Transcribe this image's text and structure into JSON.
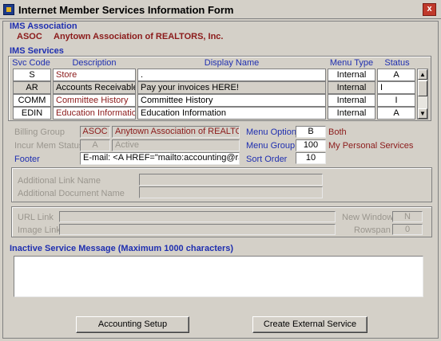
{
  "window": {
    "title": "Internet Member Services Information Form",
    "close_glyph": "x"
  },
  "association": {
    "section_label": "IMS Association",
    "code": "ASOC",
    "name": "Anytown Association of REALTORS, Inc."
  },
  "services": {
    "section_label": "IMS Services",
    "columns": {
      "svc_code": "Svc Code",
      "description": "Description",
      "display_name": "Display Name",
      "menu_type": "Menu Type",
      "status": "Status"
    },
    "rows": [
      {
        "code": "S",
        "description": "Store",
        "display_name": ".",
        "menu_type": "Internal",
        "status": "A"
      },
      {
        "code": "AR",
        "description": "Accounts Receivable",
        "display_name": "Pay your invoices HERE!",
        "menu_type": "Internal",
        "status": "I"
      },
      {
        "code": "COMM",
        "description": "Committee History",
        "display_name": "Committee History",
        "menu_type": "Internal",
        "status": "I"
      },
      {
        "code": "EDIN",
        "description": "Education Information",
        "display_name": "Education Information",
        "menu_type": "Internal",
        "status": "A"
      }
    ]
  },
  "details": {
    "billing_group_label": "Billing Group",
    "billing_group_code": "ASOC",
    "billing_group_name": "Anytown Association of REALTORS, I",
    "incur_mem_status_label": "Incur Mem Status",
    "incur_mem_status_code": "A",
    "incur_mem_status_name": "Active",
    "footer_label": "Footer",
    "footer_value": "E-mail: <A HREF=\"mailto:accounting@rapatton",
    "menu_option_label": "Menu Option",
    "menu_option_value": "B",
    "menu_option_name": "Both",
    "menu_group_label": "Menu Group",
    "menu_group_value": "100",
    "menu_group_name": "My Personal Services",
    "sort_order_label": "Sort Order",
    "sort_order_value": "10"
  },
  "additional": {
    "link_name_label": "Additional Link Name",
    "document_name_label": "Additional Document Name"
  },
  "links": {
    "url_link_label": "URL Link",
    "image_link_label": "Image Link",
    "new_window_label": "New Window",
    "new_window_value": "N",
    "rowspan_label": "Rowspan",
    "rowspan_value": "0"
  },
  "inactive": {
    "label": "Inactive Service Message (Maximum 1000 characters)",
    "value": ""
  },
  "buttons": {
    "accounting_setup": "Accounting Setup",
    "create_external_service": "Create External Service"
  },
  "colors": {
    "section_label": "#1f2fb0",
    "maroon_text": "#8b1a1a",
    "background": "#d4d0c8"
  }
}
